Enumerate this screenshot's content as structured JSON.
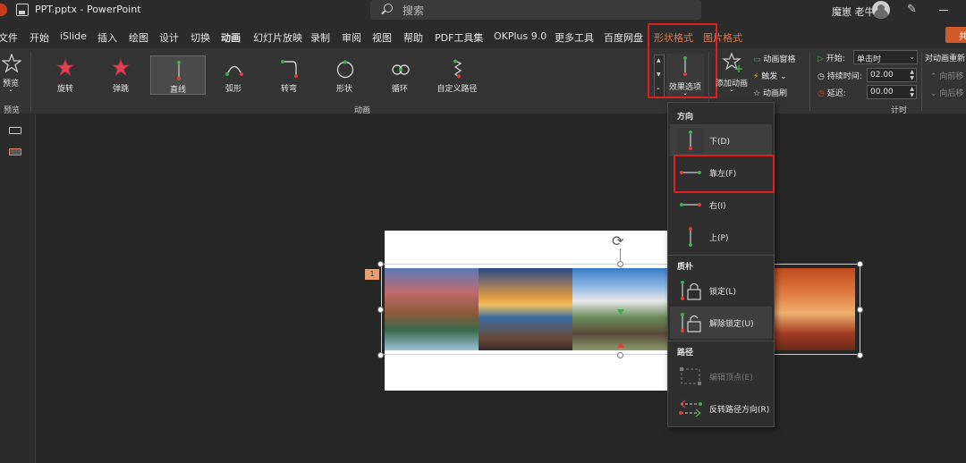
{
  "titlebar": {
    "filename": "PPT.pptx",
    "separator": "-",
    "app_name": "PowerPoint",
    "search_placeholder": "搜索",
    "user_name": "魔崽 老牛"
  },
  "menu_tabs": [
    {
      "label": "文件"
    },
    {
      "label": "开始"
    },
    {
      "label": "iSlide"
    },
    {
      "label": "插入"
    },
    {
      "label": "绘图"
    },
    {
      "label": "设计"
    },
    {
      "label": "切换"
    },
    {
      "label": "动画"
    },
    {
      "label": "幻灯片放映"
    },
    {
      "label": "录制"
    },
    {
      "label": "审阅"
    },
    {
      "label": "视图"
    },
    {
      "label": "帮助"
    },
    {
      "label": "PDF工具集"
    },
    {
      "label": "OKPlus 9.0"
    },
    {
      "label": "更多工具"
    },
    {
      "label": "百度网盘"
    },
    {
      "label": "形状格式"
    },
    {
      "label": "图片格式"
    }
  ],
  "share_label": "共",
  "ribbon": {
    "preview_label": "预览",
    "preview_group": "预览",
    "animation_group": "动画",
    "timing_group": "计时",
    "animations": [
      {
        "label": "旋转"
      },
      {
        "label": "弹跳"
      },
      {
        "label": "直线"
      },
      {
        "label": "弧形"
      },
      {
        "label": "转弯"
      },
      {
        "label": "形状"
      },
      {
        "label": "循环"
      },
      {
        "label": "自定义路径"
      }
    ],
    "effect_options_label": "效果选项",
    "add_animation_label": "添加动画",
    "animation_pane_label": "动画窗格",
    "trigger_label": "触发",
    "animation_painter_label": "动画刷",
    "start_label": "开始:",
    "start_value": "单击时",
    "duration_label": "持续时间:",
    "duration_value": "02.00",
    "delay_label": "延迟:",
    "delay_value": "00.00",
    "reorder_title": "对动画重新",
    "move_earlier": "向前移",
    "move_later": "向后移"
  },
  "slide": {
    "animation_tag": "1"
  },
  "dropdown": {
    "direction_header": "方向",
    "direction_items": [
      {
        "label": "下(D)"
      },
      {
        "label": "靠左(F)"
      },
      {
        "label": "右(I)"
      },
      {
        "label": "上(P)"
      }
    ],
    "nature_header": "质朴",
    "nature_items": [
      {
        "label": "锁定(L)"
      },
      {
        "label": "解除锁定(U)"
      }
    ],
    "path_header": "路径",
    "path_items": [
      {
        "label": "编辑顶点(E)"
      },
      {
        "label": "反转路径方向(R)"
      }
    ]
  },
  "colors": {
    "highlight_red": "#e01e1e",
    "accent_orange": "#e0784a",
    "path_green": "#3fae49",
    "path_red": "#e03c3c"
  }
}
